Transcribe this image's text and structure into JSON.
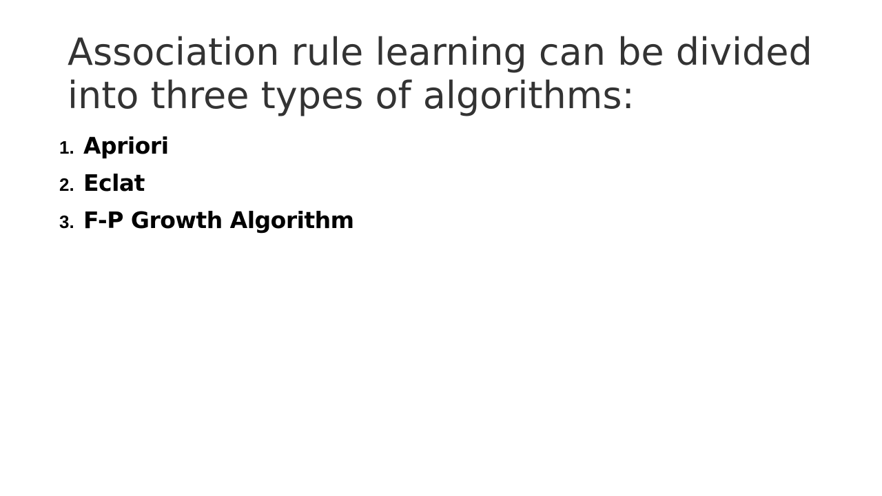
{
  "slide": {
    "title": "Association rule learning can be divided into three types of algorithms:",
    "items": [
      {
        "number": "1.",
        "label": "Apriori"
      },
      {
        "number": "2.",
        "label": "Eclat"
      },
      {
        "number": "3.",
        "label": "F-P Growth Algorithm"
      }
    ]
  },
  "colors": {
    "background": "#ffffff",
    "title_text": "#333333",
    "list_text": "#000000"
  }
}
